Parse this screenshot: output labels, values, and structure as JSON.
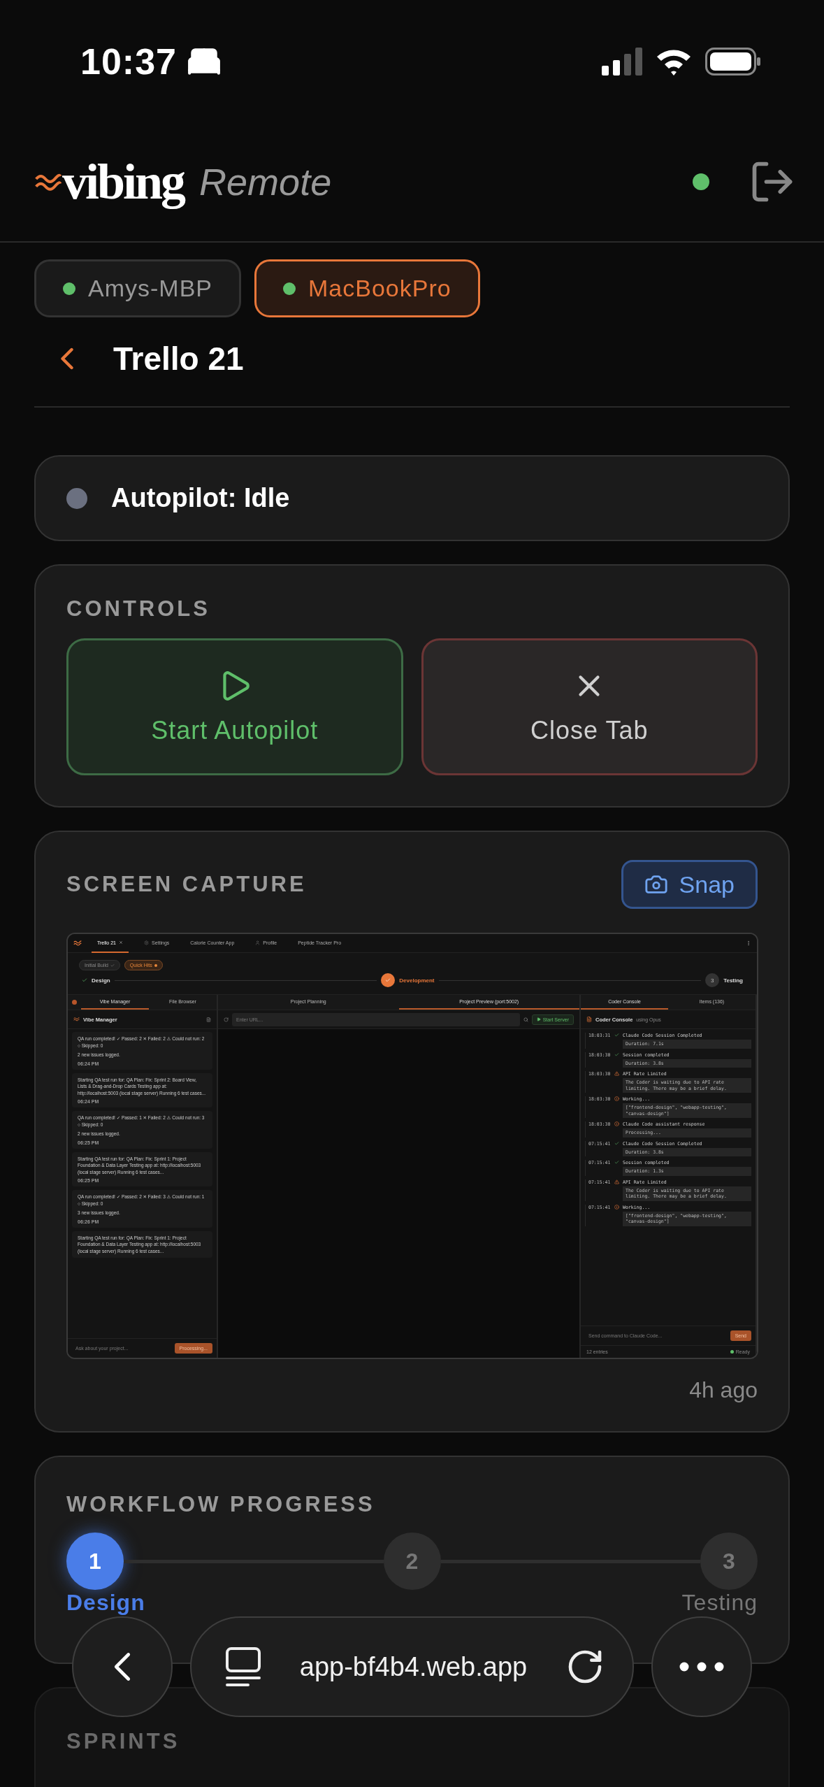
{
  "status_bar": {
    "time": "10:37"
  },
  "header": {
    "logo": "vibing",
    "subtitle": "Remote",
    "connected": true
  },
  "machines": [
    {
      "name": "Amys-MBP",
      "selected": false
    },
    {
      "name": "MacBookPro",
      "selected": true
    }
  ],
  "project": {
    "title": "Trello 21"
  },
  "autopilot": {
    "status": "Autopilot: Idle",
    "active": false
  },
  "controls": {
    "title": "CONTROLS",
    "buttons": [
      {
        "kind": "start",
        "label": "Start Autopilot"
      },
      {
        "kind": "close",
        "label": "Close Tab"
      }
    ]
  },
  "screen_capture": {
    "title": "SCREEN CAPTURE",
    "snap_label": "Snap",
    "age": "4h ago",
    "capture": {
      "tabs": [
        {
          "label": "Trello 21",
          "kind": "closable",
          "selected": true
        },
        {
          "label": "Settings",
          "kind": "gear",
          "selected": false
        },
        {
          "label": "Calorie Counter App",
          "kind": "plain",
          "selected": false
        },
        {
          "label": "Profile",
          "kind": "person",
          "selected": false
        },
        {
          "label": "Peptide Tracker Pro",
          "kind": "plain",
          "selected": false
        }
      ],
      "chips": [
        {
          "label": "Initial Build",
          "kind": "done"
        },
        {
          "label": "Quick Hits",
          "kind": "current"
        }
      ],
      "stages": [
        {
          "label": "Design",
          "kind": "done"
        },
        {
          "label": "Development",
          "kind": "current"
        },
        {
          "label": "Testing",
          "number": "3",
          "kind": "pending"
        }
      ],
      "left_panel": {
        "tabs": [
          {
            "label": "Vibe Manager",
            "selected": true
          },
          {
            "label": "File Browser",
            "selected": false
          }
        ],
        "title": "Vibe Manager",
        "messages": [
          {
            "text": "QA run completed! ✓ Passed: 2 ✕ Failed: 2 ⚠ Could not run: 2 ○ Skipped: 0",
            "note": "2 new issues logged.",
            "time": "06:24 PM"
          },
          {
            "text": "Starting QA test run for: QA Plan: Fix: Sprint 2: Board View, Lists & Drag-and-Drop Cards Testing app at: http://localhost:5003 (local stage server) Running 6 test cases...",
            "time": "06:24 PM"
          },
          {
            "text": "QA run completed! ✓ Passed: 1 ✕ Failed: 2 ⚠ Could not run: 3 ○ Skipped: 0",
            "note": "2 new issues logged.",
            "time": "06:25 PM"
          },
          {
            "text": "Starting QA test run for: QA Plan: Fix: Sprint 1: Project Foundation & Data Layer Testing app at: http://localhost:5003 (local stage server) Running 6 test cases...",
            "time": "06:25 PM"
          },
          {
            "text": "QA run completed! ✓ Passed: 2 ✕ Failed: 3 ⚠ Could not run: 1 ○ Skipped: 0",
            "note": "3 new issues logged.",
            "time": "06:26 PM"
          },
          {
            "text": "Starting QA test run for: QA Plan: Fix: Sprint 1: Project Foundation & Data Layer Testing app at: http://localhost:5003 (local stage server) Running 6 test cases..."
          }
        ],
        "input_placeholder": "Ask about your project...",
        "button": "Processing..."
      },
      "middle_panel": {
        "tabs": [
          {
            "label": "Project Planning",
            "selected": false
          },
          {
            "label": "Project Preview (port:5002)",
            "selected": true
          }
        ],
        "url_placeholder": "Enter URL...",
        "server_button": "Start Server"
      },
      "right_panel": {
        "tabs": [
          {
            "label": "Coder Console",
            "selected": true
          },
          {
            "label": "Items (136)",
            "selected": false
          }
        ],
        "title": "Coder Console",
        "model": "using Opus",
        "entries": [
          {
            "time": "18:03:31",
            "kind": "success",
            "title": "Claude Code Session Completed",
            "detail": "Duration: 7.1s"
          },
          {
            "time": "18:03:30",
            "kind": "success",
            "title": "Session completed",
            "detail": "Duration: 3.8s"
          },
          {
            "time": "18:03:30",
            "kind": "warning",
            "title": "API Rate Limited",
            "detail": "The Coder is waiting due to API rate limiting. There may be a brief delay."
          },
          {
            "time": "18:03:30",
            "kind": "info",
            "title": "Working...",
            "detail": "[\"frontend-design\", \"webapp-testing\", \"canvas-design\"]"
          },
          {
            "time": "18:03:30",
            "kind": "info",
            "title": "Claude Code assistant response",
            "detail": "Processing..."
          },
          {
            "time": "07:15:41",
            "kind": "success",
            "title": "Claude Code Session Completed",
            "detail": "Duration: 3.8s"
          },
          {
            "time": "07:15:41",
            "kind": "success",
            "title": "Session completed",
            "detail": "Duration: 1.3s"
          },
          {
            "time": "07:15:41",
            "kind": "warning",
            "title": "API Rate Limited",
            "detail": "The Coder is waiting due to API rate limiting. There may be a brief delay."
          },
          {
            "time": "07:15:41",
            "kind": "info",
            "title": "Working...",
            "detail": "[\"frontend-design\", \"webapp-testing\", \"canvas-design\"]"
          }
        ],
        "input_placeholder": "Send command to Claude Code...",
        "send": "Send",
        "count": "12 entries",
        "status": "Ready"
      }
    }
  },
  "workflow": {
    "title": "WORKFLOW PROGRESS",
    "steps": [
      {
        "number": "1",
        "label": "Design",
        "selected": true
      },
      {
        "number": "2",
        "selected": false
      },
      {
        "number": "3",
        "label": "Testing",
        "selected": false
      }
    ]
  },
  "sprints": {
    "title": "SPRINTS"
  },
  "browser_bar": {
    "url": "app-bf4b4.web.app"
  }
}
